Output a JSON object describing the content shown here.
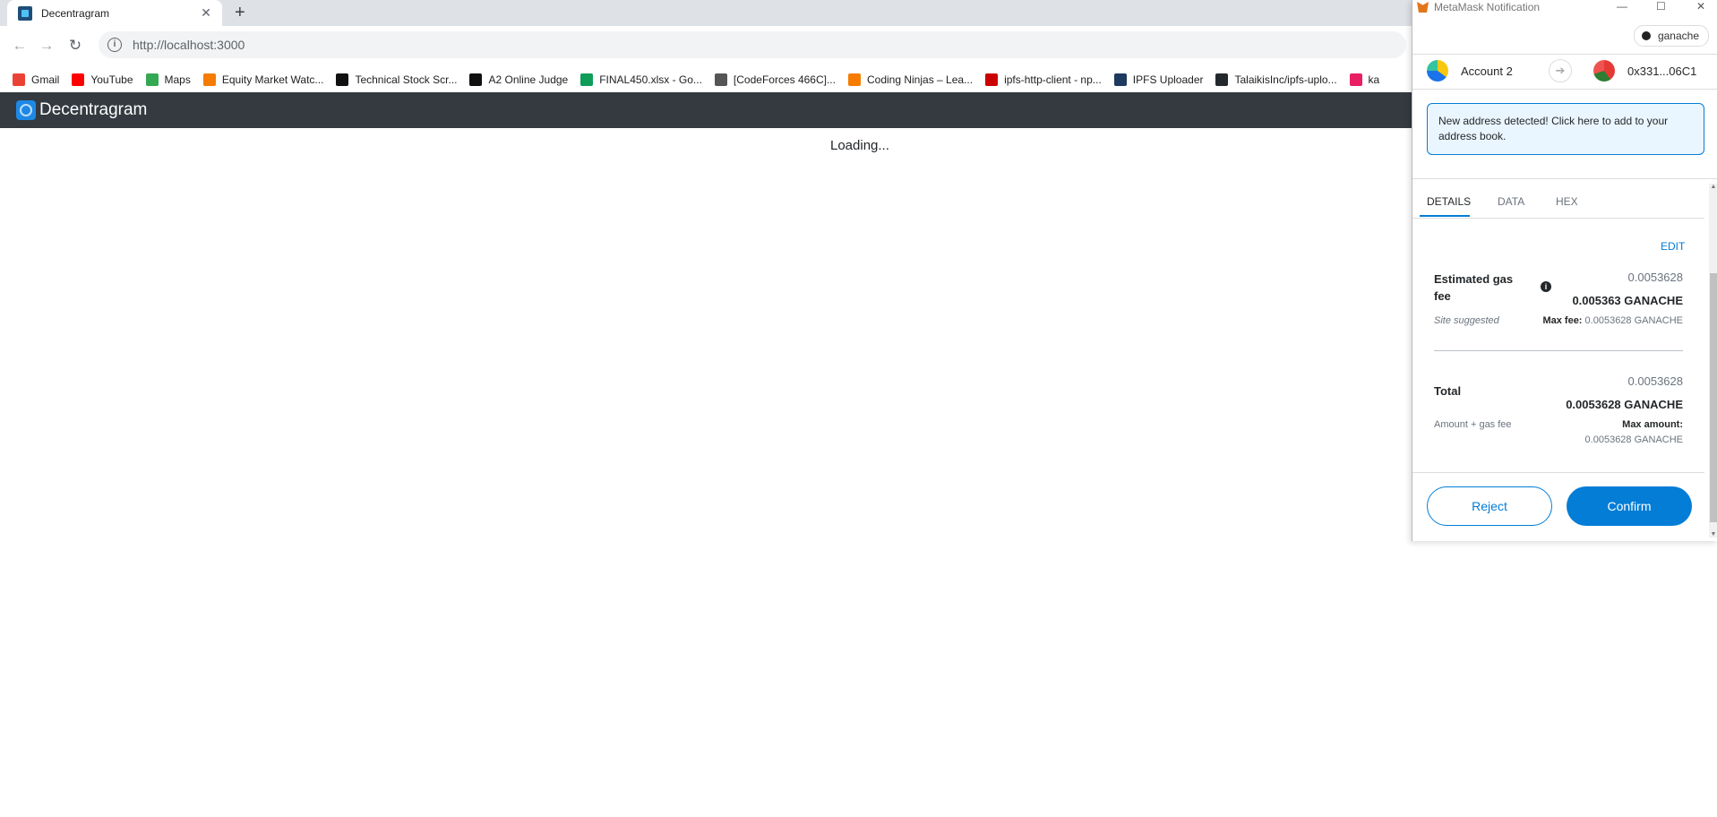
{
  "browser": {
    "tab_title": "Decentragram",
    "url": "http://localhost:3000",
    "bookmarks": [
      {
        "label": "Gmail",
        "color": "#ea4335"
      },
      {
        "label": "YouTube",
        "color": "#ff0000"
      },
      {
        "label": "Maps",
        "color": "#34a853"
      },
      {
        "label": "Equity Market Watc...",
        "color": "#f57c00"
      },
      {
        "label": "Technical Stock Scr...",
        "color": "#111111"
      },
      {
        "label": "A2 Online Judge",
        "color": "#111111"
      },
      {
        "label": "FINAL450.xlsx - Go...",
        "color": "#0f9d58"
      },
      {
        "label": "[CodeForces 466C]...",
        "color": "#555555"
      },
      {
        "label": "Coding Ninjas – Lea...",
        "color": "#f57c00"
      },
      {
        "label": "ipfs-http-client - np...",
        "color": "#cb0000"
      },
      {
        "label": "IPFS Uploader",
        "color": "#1e3a5f"
      },
      {
        "label": "TalaikisInc/ipfs-uplo...",
        "color": "#24292e"
      },
      {
        "label": "ka",
        "color": "#e91e63"
      }
    ]
  },
  "page": {
    "brand": "Decentragram",
    "loading_text": "Loading..."
  },
  "metamask": {
    "window_title": "MetaMask Notification",
    "network": "ganache",
    "from_account": "Account 2",
    "to_address": "0x331...06C1",
    "alert": "New address detected! Click here to add to your address book.",
    "tabs": [
      "DETAILS",
      "DATA",
      "HEX"
    ],
    "edit_label": "EDIT",
    "gas": {
      "label": "Estimated gas fee",
      "value_secondary": "0.0053628",
      "value_primary": "0.005363 GANACHE",
      "suggested_label": "Site suggested",
      "max_fee_label": "Max fee:",
      "max_fee_value": "0.0053628 GANACHE"
    },
    "total": {
      "label": "Total",
      "value_secondary": "0.0053628",
      "value_primary": "0.0053628 GANACHE",
      "sub_label": "Amount + gas fee",
      "max_amount_label": "Max amount:",
      "max_amount_value": "0.0053628 GANACHE"
    },
    "reject_label": "Reject",
    "confirm_label": "Confirm"
  }
}
